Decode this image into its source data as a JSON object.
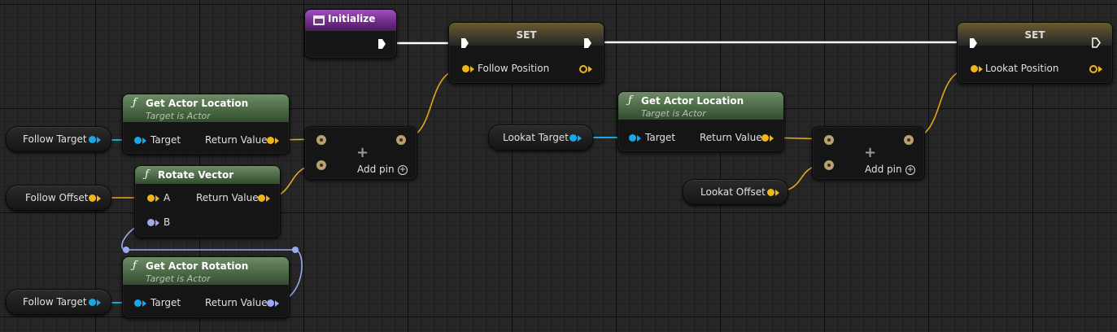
{
  "colors": {
    "vector_pin": "#f0b51b",
    "object_pin": "#19a6e8",
    "rotator_pin": "#9aa9f2",
    "function_header": "#4b6a45",
    "event_header": "#6d2b86",
    "exec": "#ffffff"
  },
  "event_node": {
    "title": "Initialize",
    "icon": "event-icon"
  },
  "set_nodes": [
    {
      "title": "SET",
      "variable": "Follow Position"
    },
    {
      "title": "SET",
      "variable": "Lookat Position"
    }
  ],
  "func_nodes": {
    "get_actor_location_1": {
      "icon": "function-icon",
      "title": "Get Actor Location",
      "subtitle": "Target is Actor",
      "input": "Target",
      "output": "Return Value"
    },
    "rotate_vector": {
      "icon": "function-icon",
      "title": "Rotate Vector",
      "input_a": "A",
      "input_b": "B",
      "output": "Return Value"
    },
    "get_actor_rotation": {
      "icon": "function-icon",
      "title": "Get Actor Rotation",
      "subtitle": "Target is Actor",
      "input": "Target",
      "output": "Return Value"
    },
    "get_actor_location_2": {
      "icon": "function-icon",
      "title": "Get Actor Location",
      "subtitle": "Target is Actor",
      "input": "Target",
      "output": "Return Value"
    }
  },
  "add_nodes": [
    {
      "symbol": "+",
      "add_pin": "Add pin"
    },
    {
      "symbol": "+",
      "add_pin": "Add pin"
    }
  ],
  "variables": {
    "follow_target_1": "Follow Target",
    "follow_offset": "Follow Offset",
    "follow_target_2": "Follow Target",
    "lookat_target": "Lookat Target",
    "lookat_offset": "Lookat Offset"
  }
}
